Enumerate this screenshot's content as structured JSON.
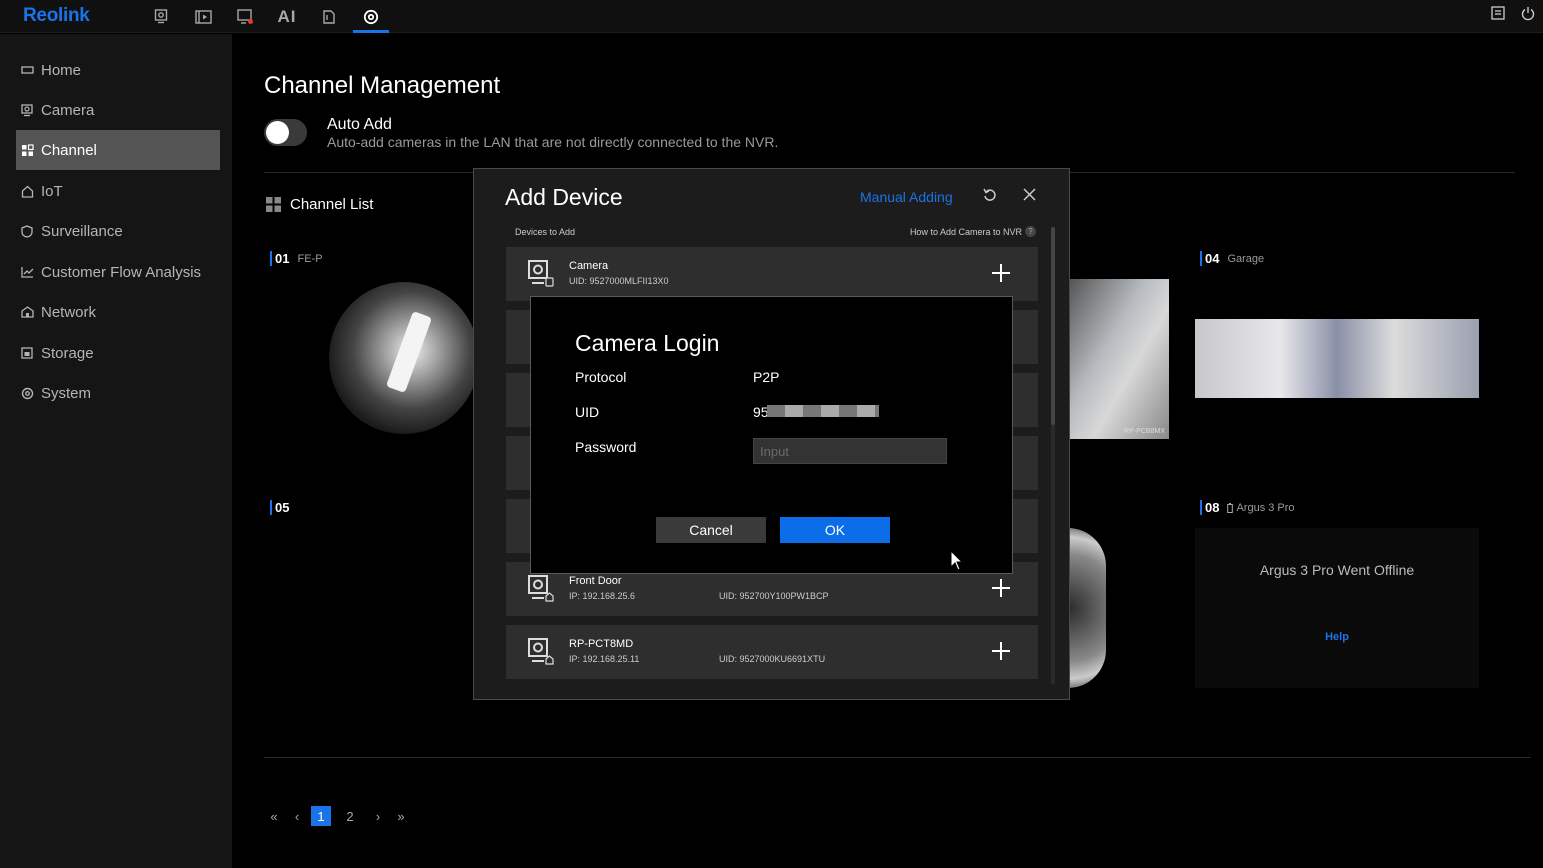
{
  "app": {
    "logo": "Reolink",
    "accent": "#1a73e8"
  },
  "topnav": {
    "items": [
      {
        "icon": "camera-icon"
      },
      {
        "icon": "playback-icon"
      },
      {
        "icon": "alarm-icon"
      },
      {
        "label": "AI"
      },
      {
        "icon": "file-icon"
      },
      {
        "icon": "settings-icon",
        "active": true
      }
    ],
    "right_icons": [
      "notes-icon",
      "power-icon"
    ]
  },
  "sidebar": {
    "items": [
      {
        "label": "Home",
        "icon": "home-icon"
      },
      {
        "label": "Camera",
        "icon": "camera-icon"
      },
      {
        "label": "Channel",
        "icon": "grid-icon",
        "active": true
      },
      {
        "label": "IoT",
        "icon": "iot-icon"
      },
      {
        "label": "Surveillance",
        "icon": "shield-icon"
      },
      {
        "label": "Customer Flow Analysis",
        "icon": "chart-icon"
      },
      {
        "label": "Network",
        "icon": "network-icon"
      },
      {
        "label": "Storage",
        "icon": "storage-icon"
      },
      {
        "label": "System",
        "icon": "gear-icon"
      }
    ]
  },
  "main": {
    "title": "Channel Management",
    "auto_add": {
      "title": "Auto Add",
      "description": "Auto-add cameras in the LAN that are not directly connected to the NVR.",
      "enabled": false
    },
    "channel_list_title": "Channel List",
    "channels": [
      {
        "num": "01",
        "name": "FE-P"
      },
      {
        "num": "04",
        "name": "Garage"
      },
      {
        "num": "05",
        "name": ""
      },
      {
        "num": "08",
        "name": "Argus 3 Pro"
      }
    ],
    "thumb_watermark": "RP-PCB8MX",
    "offline": {
      "message": "Argus 3 Pro Went Offline",
      "help": "Help"
    },
    "pagination": {
      "pages": [
        "1",
        "2"
      ],
      "current": "1"
    }
  },
  "dialog": {
    "title": "Add Device",
    "manual_adding": "Manual Adding",
    "devices_to_add": "Devices to Add",
    "how_to": "How to Add Camera to NVR",
    "devices": [
      {
        "name": "Camera",
        "sub": "UID: 9527000MLFII13X0",
        "uid": ""
      },
      {
        "name": "Front Door",
        "sub": "IP: 192.168.25.6",
        "uid": "UID: 952700Y100PW1BCP"
      },
      {
        "name": "RP-PCT8MD",
        "sub": "IP: 192.168.25.11",
        "uid": "UID: 9527000KU6691XTU"
      }
    ]
  },
  "login": {
    "title": "Camera Login",
    "protocol_label": "Protocol",
    "protocol_value": "P2P",
    "uid_label": "UID",
    "uid_value": "952",
    "password_label": "Password",
    "password_placeholder": "Input",
    "cancel": "Cancel",
    "ok": "OK"
  }
}
